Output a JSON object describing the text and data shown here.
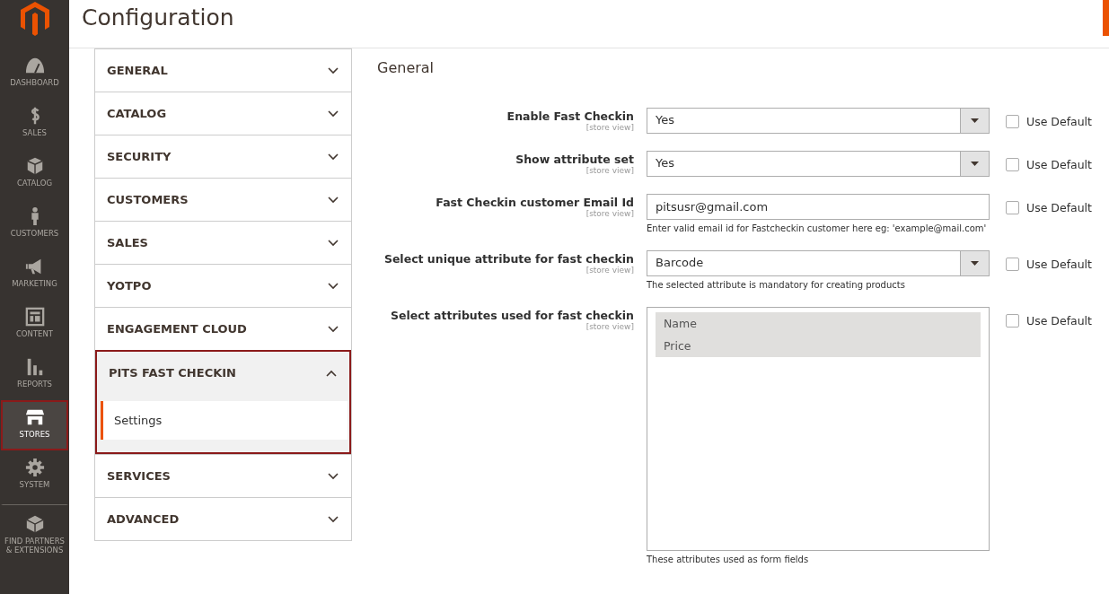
{
  "sidebar": {
    "items": [
      {
        "label": "DASHBOARD",
        "kind": "gauge",
        "selected": false,
        "annotated": false
      },
      {
        "label": "SALES",
        "kind": "dollar",
        "selected": false,
        "annotated": false
      },
      {
        "label": "CATALOG",
        "kind": "box",
        "selected": false,
        "annotated": false
      },
      {
        "label": "CUSTOMERS",
        "kind": "person",
        "selected": false,
        "annotated": false
      },
      {
        "label": "MARKETING",
        "kind": "megaphone",
        "selected": false,
        "annotated": false
      },
      {
        "label": "CONTENT",
        "kind": "layout",
        "selected": false,
        "annotated": false
      },
      {
        "label": "REPORTS",
        "kind": "bars",
        "selected": false,
        "annotated": false
      },
      {
        "label": "STORES",
        "kind": "store",
        "selected": true,
        "annotated": true
      },
      {
        "label": "SYSTEM",
        "kind": "gear",
        "selected": false,
        "annotated": false
      },
      {
        "label": "FIND PARTNERS & EXTENSIONS",
        "kind": "blocks",
        "selected": false,
        "annotated": false
      }
    ]
  },
  "page": {
    "title": "Configuration"
  },
  "sections": [
    {
      "label": "GENERAL",
      "expanded": false,
      "annotated": false
    },
    {
      "label": "CATALOG",
      "expanded": false,
      "annotated": false
    },
    {
      "label": "SECURITY",
      "expanded": false,
      "annotated": false
    },
    {
      "label": "CUSTOMERS",
      "expanded": false,
      "annotated": false
    },
    {
      "label": "SALES",
      "expanded": false,
      "annotated": false
    },
    {
      "label": "YOTPO",
      "expanded": false,
      "annotated": false
    },
    {
      "label": "ENGAGEMENT CLOUD",
      "expanded": false,
      "annotated": false
    },
    {
      "label": "PITS FAST CHECKIN",
      "expanded": true,
      "annotated": true,
      "children": [
        {
          "label": "Settings",
          "selected": true
        }
      ]
    },
    {
      "label": "SERVICES",
      "expanded": false,
      "annotated": false
    },
    {
      "label": "ADVANCED",
      "expanded": false,
      "annotated": false
    }
  ],
  "form": {
    "title": "General",
    "fields": [
      {
        "kind": "select",
        "label": "Enable Fast Checkin",
        "scope": "[store view]",
        "value": "Yes",
        "use_default_label": "Use Default",
        "use_default": false
      },
      {
        "kind": "select",
        "label": "Show attribute set",
        "scope": "[store view]",
        "value": "Yes",
        "use_default_label": "Use Default",
        "use_default": false
      },
      {
        "kind": "text",
        "label": "Fast Checkin customer Email Id",
        "scope": "[store view]",
        "value": "pitsusr@gmail.com",
        "note": "Enter valid email id for Fastcheckin customer here eg: 'example@mail.com'",
        "use_default_label": "Use Default",
        "use_default": false
      },
      {
        "kind": "select",
        "label": "Select unique attribute for fast checkin",
        "scope": "[store view]",
        "value": "Barcode",
        "note": "The selected attribute is mandatory for creating products",
        "use_default_label": "Use Default",
        "use_default": false
      },
      {
        "kind": "multiselect",
        "label": "Select attributes used for fast checkin",
        "scope": "[store view]",
        "options": [
          {
            "label": "Name",
            "selected": true
          },
          {
            "label": "Price",
            "selected": true
          }
        ],
        "note": "These attributes used as form fields",
        "use_default_label": "Use Default",
        "use_default": false
      }
    ]
  }
}
